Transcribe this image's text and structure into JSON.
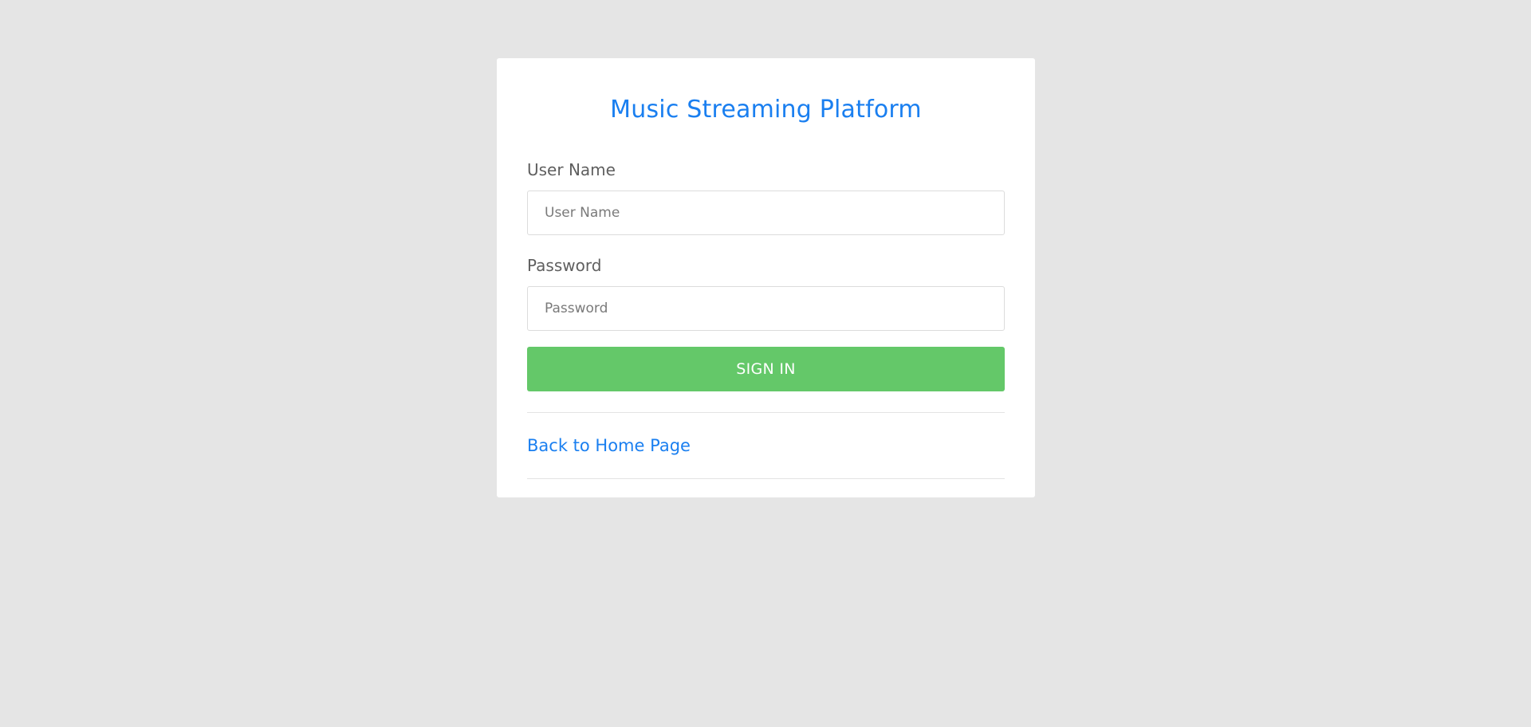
{
  "page": {
    "background_color": "#e5e5e5"
  },
  "login_card": {
    "title": "Music Streaming Platform",
    "username": {
      "label": "User Name",
      "placeholder": "User Name",
      "value": ""
    },
    "password": {
      "label": "Password",
      "placeholder": "Password",
      "value": ""
    },
    "signin_label": "SIGN IN",
    "home_link_label": "Back to Home Page"
  },
  "colors": {
    "accent_blue": "#1a7ff0",
    "signin_green": "#64c869",
    "card_background": "#ffffff"
  }
}
